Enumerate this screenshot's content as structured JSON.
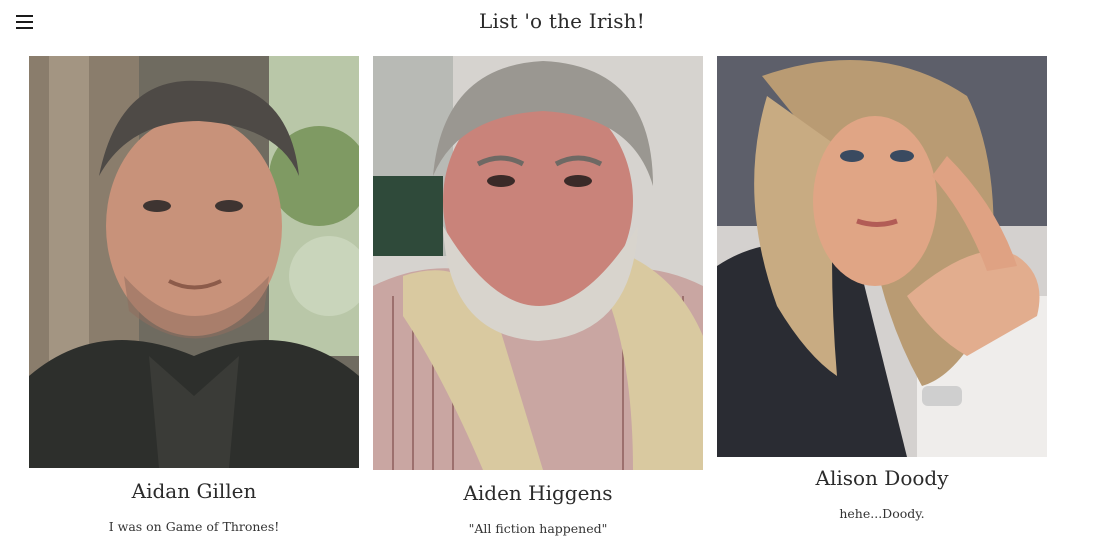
{
  "header": {
    "menu_icon": "hamburger-menu-icon",
    "title": "List 'o the Irish!"
  },
  "people": [
    {
      "name": "Aidan Gillen",
      "bio": "I was on Game of Thrones!",
      "photo_alt": "Aidan Gillen photo"
    },
    {
      "name": "Aiden Higgens",
      "bio": "\"All fiction happened\"",
      "photo_alt": "Aiden Higgens photo"
    },
    {
      "name": "Alison Doody",
      "bio": "hehe...Doody.",
      "photo_alt": "Alison Doody photo"
    }
  ]
}
